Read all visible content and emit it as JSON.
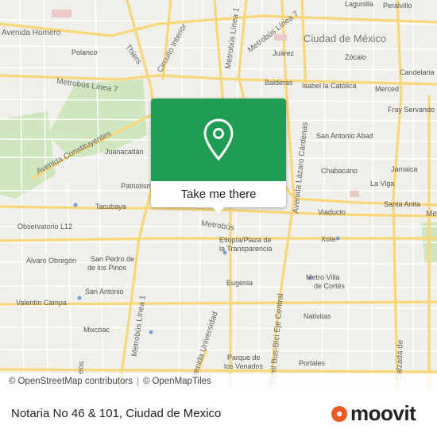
{
  "map": {
    "labels": {
      "lagunilla": "Lagunilla",
      "peralvillo": "Peralvillo",
      "avenida_homero": "Avenida Homero",
      "polanco": "Polanco",
      "thiers": "Thiers",
      "circuito_interior": "Circuito Interior",
      "metrobus_linea1_n": "Metrobús Línea 1",
      "metrobus_linea7_n": "Metrobús Línea 7",
      "ciudad_de_mexico": "Ciudad de México",
      "juarez": "Juárez",
      "zocalo": "Zócalo",
      "candelaria": "Candelaria",
      "metrobus_linea7": "Metrobús Línea 7",
      "balderas": "Balderas",
      "isabel_la_catolica": "Isabel la Católica",
      "merced": "Merced",
      "fray_servando": "Fray Servando",
      "avenida_constituyentes": "Avenida Constituyentes",
      "juanacatlan": "Juanacatlán",
      "san_antonio_abad": "San Antonio Abad",
      "avenida_lazaro_cardenas": "Avenida Lázaro Cárdenas",
      "chabacano": "Chabacano",
      "jamaica": "Jamaica",
      "patriotismo": "Patriotismo",
      "la_viga": "La Viga",
      "tacubaya": "Tacubaya",
      "santa_anita": "Santa Anita",
      "viaducto": "Viaducto",
      "observatorio": "Observatorio L12",
      "metrobus": "Metrobús",
      "xola": "Xola",
      "etiopia": "Etiopía/Plaza de",
      "la_transparencia": "la Transparencia",
      "alvaro_obregon": "Álvaro Obregón",
      "san_pedro": "San Pedro de",
      "los_pinos": "de los Pinos",
      "eugenia": "Eugenia",
      "metro_villa": "Metro Villa",
      "de_cortes": "de Cortés",
      "san_antonio": "San Antonio",
      "valentin_campa": "Valentín Campa",
      "metrobus_linea1_s": "Metrobús Línea 1",
      "carril_bus": "Carril Bus-Bici Eje Central",
      "nativitas": "Nativitas",
      "mixcoac": "Mixcoac",
      "avda_universidad": "Avenida Universidad",
      "calzada": "Calzada de",
      "parque": "Parque de",
      "los_venados": "los Venados",
      "portales": "Portales",
      "me_edge": "Me",
      "eos": "eos"
    },
    "colors": {
      "background": "#f1efe9",
      "park": "#cfe6bf",
      "major_road": "#f8d77a",
      "minor_road": "#ffffff",
      "pin_green": "#1f9d55"
    }
  },
  "popup": {
    "button_label": "Take me there",
    "pin_icon": "map-pin-icon"
  },
  "attribution": {
    "copyright_symbol_1": "©",
    "osm_contributors": "OpenStreetMap contributors",
    "separator": "|",
    "copyright_symbol_2": "©",
    "omt": "OpenMapTiles"
  },
  "footer": {
    "title": "Notaria No 46 & 101, Ciudad de Mexico",
    "brand": "moovit",
    "brand_color": "#ee5a24"
  }
}
